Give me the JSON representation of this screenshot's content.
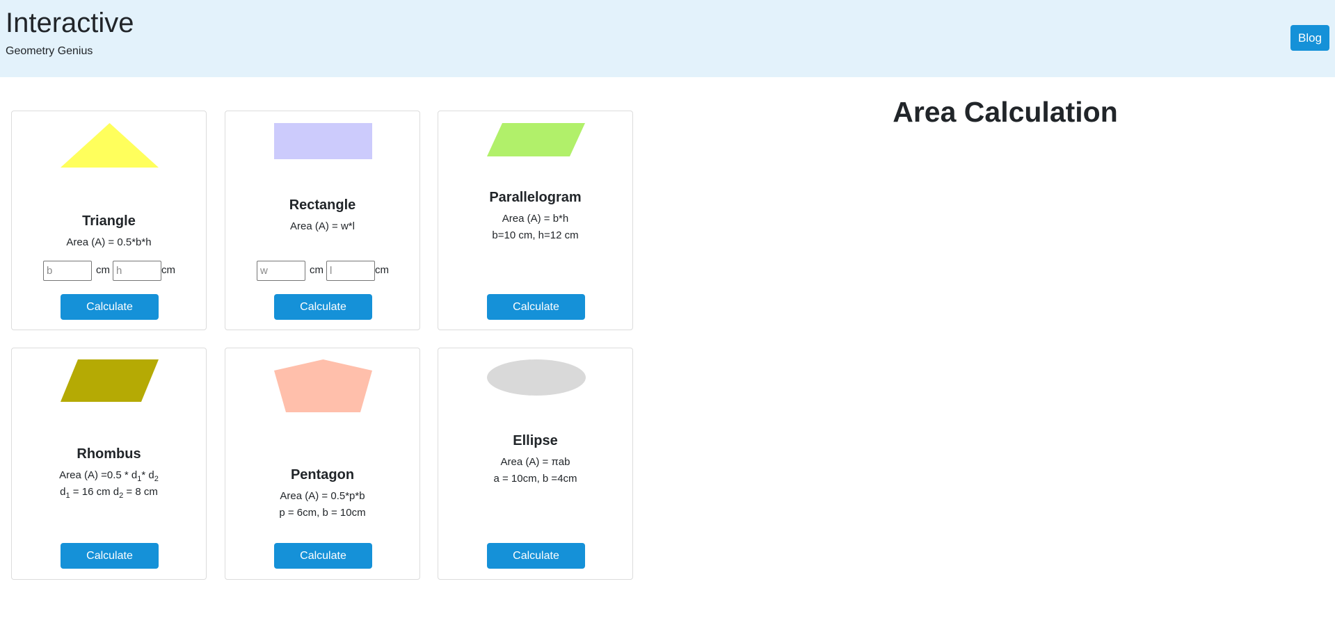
{
  "header": {
    "title": "Interactive",
    "subtitle": "Geometry Genius",
    "blog_label": "Blog"
  },
  "main": {
    "heading": "Area Calculation"
  },
  "cards": {
    "triangle": {
      "title": "Triangle",
      "formula": "Area (A) = 0.5*b*h",
      "input1_placeholder": "b",
      "input2_placeholder": "h",
      "unit1": "cm",
      "unit2": "cm",
      "button": "Calculate",
      "color": "#ffff5c"
    },
    "rectangle": {
      "title": "Rectangle",
      "formula": "Area (A) = w*l",
      "input1_placeholder": "w",
      "input2_placeholder": "l",
      "unit1": "cm",
      "unit2": "cm",
      "button": "Calculate",
      "color": "#cccbfc"
    },
    "parallelogram": {
      "title": "Parallelogram",
      "formula": "Area (A) = b*h",
      "values": "b=10 cm, h=12 cm",
      "button": "Calculate",
      "color": "#b1f06a"
    },
    "rhombus": {
      "title": "Rhombus",
      "formula_prefix": "Area (A) =0.5 * d",
      "formula_sub1": "1",
      "formula_mid": "* d",
      "formula_sub2": "2",
      "values_d1": "d",
      "values_sub1": "1",
      "values_mid": " = 16 cm d",
      "values_sub2": "2",
      "values_end": " = 8 cm",
      "button": "Calculate",
      "color": "#b5aa04"
    },
    "pentagon": {
      "title": "Pentagon",
      "formula": "Area (A) = 0.5*p*b",
      "values": "p = 6cm, b = 10cm",
      "button": "Calculate",
      "color": "#ffbfab"
    },
    "ellipse": {
      "title": "Ellipse",
      "formula": "Area (A) = πab",
      "values": "a = 10cm, b =4cm",
      "button": "Calculate",
      "color": "#d9d9d9"
    }
  }
}
